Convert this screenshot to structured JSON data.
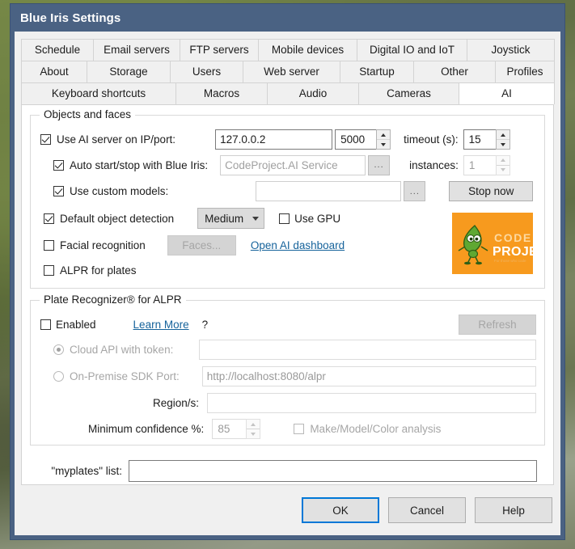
{
  "window": {
    "title": "Blue Iris Settings"
  },
  "tabs": {
    "row1": [
      {
        "label": "Schedule",
        "selected": false
      },
      {
        "label": "Email servers",
        "selected": false
      },
      {
        "label": "FTP servers",
        "selected": false
      },
      {
        "label": "Mobile devices",
        "selected": false
      },
      {
        "label": "Digital IO and IoT",
        "selected": false
      },
      {
        "label": "Joystick",
        "selected": false
      }
    ],
    "row2": [
      {
        "label": "About",
        "selected": false
      },
      {
        "label": "Storage",
        "selected": false
      },
      {
        "label": "Users",
        "selected": false
      },
      {
        "label": "Web server",
        "selected": false
      },
      {
        "label": "Startup",
        "selected": false
      },
      {
        "label": "Other",
        "selected": false
      },
      {
        "label": "Profiles",
        "selected": false
      }
    ],
    "row3": [
      {
        "label": "Keyboard shortcuts",
        "selected": false
      },
      {
        "label": "Macros",
        "selected": false
      },
      {
        "label": "Audio",
        "selected": false
      },
      {
        "label": "Cameras",
        "selected": false
      },
      {
        "label": "AI",
        "selected": true
      }
    ]
  },
  "objects_and_faces": {
    "group_title": "Objects and faces",
    "use_ai_server": {
      "label": "Use AI server on IP/port:",
      "checked": true,
      "ip_value": "127.0.0.2",
      "port_value": "5000"
    },
    "timeout": {
      "label": "timeout (s):",
      "value": "15"
    },
    "auto_start_stop": {
      "label": "Auto start/stop with Blue Iris:",
      "checked": true,
      "value": "CodeProject.AI Service",
      "browse_label": "..."
    },
    "instances": {
      "label": "instances:",
      "value": "1"
    },
    "use_custom_models": {
      "label": "Use custom models:",
      "checked": true,
      "value": "",
      "browse_label": "..."
    },
    "stop_now_label": "Stop now",
    "default_object_detection": {
      "label": "Default object detection",
      "checked": true,
      "quality_value": "Medium"
    },
    "use_gpu": {
      "label": "Use GPU",
      "checked": false
    },
    "facial_recognition": {
      "label": "Facial recognition",
      "checked": false
    },
    "faces_button_label": "Faces...",
    "open_ai_dashboard_label": "Open AI dashboard",
    "alpr_for_plates": {
      "label": "ALPR for plates",
      "checked": false
    },
    "logo": {
      "name": "codeproject-logo",
      "line1": "CODE",
      "line2": "PROJECT",
      "tagline": "For those who code",
      "bg_color": "#f79a1e"
    }
  },
  "plate_recognizer": {
    "group_title": "Plate Recognizer® for ALPR",
    "enabled": {
      "label": "Enabled",
      "checked": false
    },
    "learn_more_label": "Learn More",
    "help_label": "?",
    "refresh_label": "Refresh",
    "cloud_api": {
      "label": "Cloud API with token:",
      "selected": true,
      "value": ""
    },
    "on_premise": {
      "label": "On-Premise SDK Port:",
      "selected": false,
      "value": "http://localhost:8080/alpr"
    },
    "regions": {
      "label": "Region/s:",
      "value": ""
    },
    "minimum_confidence": {
      "label": "Minimum confidence %:",
      "value": "85"
    },
    "make_model_color": {
      "label": "Make/Model/Color analysis",
      "checked": false
    }
  },
  "myplates": {
    "label": "\"myplates\" list:",
    "value": ""
  },
  "footer": {
    "ok_label": "OK",
    "cancel_label": "Cancel",
    "help_label": "Help"
  },
  "colors": {
    "titlebar": "#4a6283",
    "accent_link": "#16639b",
    "focus_border": "#0078d7",
    "logo_orange": "#f79a1e"
  }
}
